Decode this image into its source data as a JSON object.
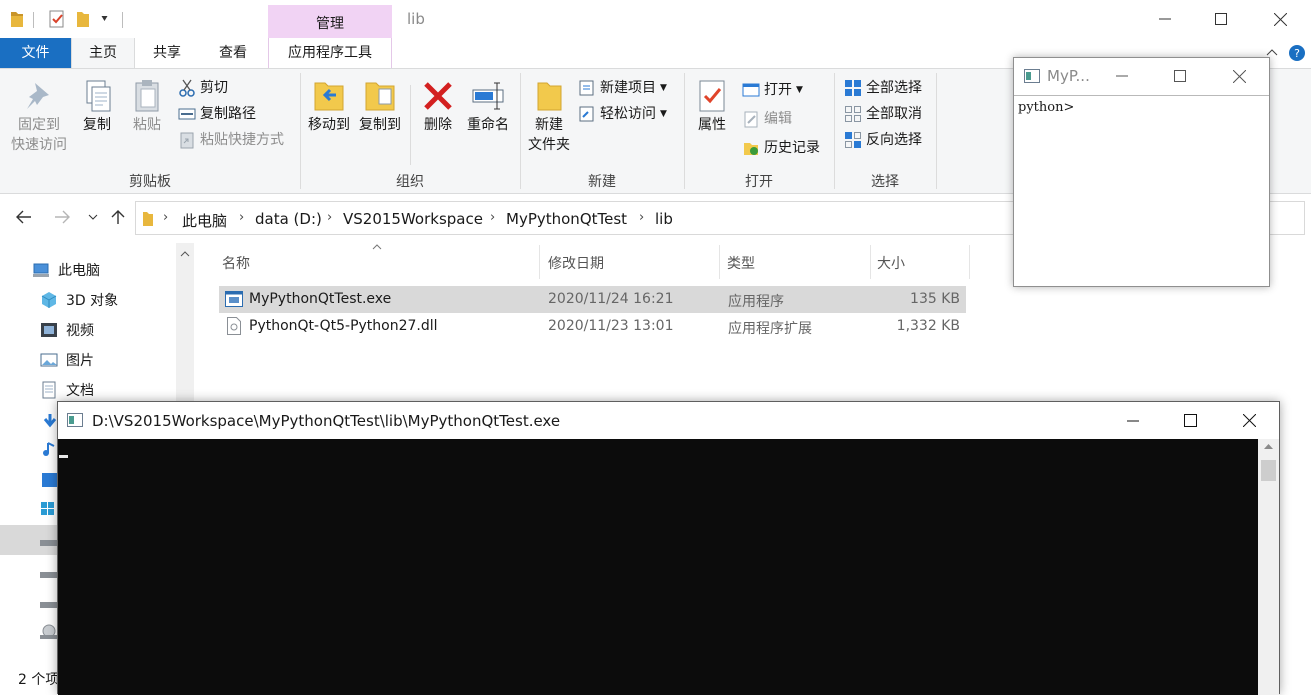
{
  "titlebar": {
    "context_tab_header": "管理",
    "window_title": "lib"
  },
  "ribbon_tabs": {
    "file": "文件",
    "home": "主页",
    "share": "共享",
    "view": "查看",
    "app_tools": "应用程序工具"
  },
  "ribbon": {
    "clipboard": {
      "pin": "固定到快速访问",
      "pin_line1": "固定到",
      "pin_line2": "快速访问",
      "copy": "复制",
      "paste": "粘贴",
      "cut": "剪切",
      "copy_path": "复制路径",
      "paste_shortcut": "粘贴快捷方式",
      "label": "剪贴板"
    },
    "organize": {
      "move_to": "移动到",
      "copy_to": "复制到",
      "delete": "删除",
      "rename": "重命名",
      "label": "组织"
    },
    "new": {
      "new_folder_line1": "新建",
      "new_folder_line2": "文件夹",
      "new_item": "新建项目",
      "easy_access": "轻松访问",
      "label": "新建"
    },
    "open": {
      "properties": "属性",
      "open": "打开",
      "edit": "编辑",
      "history": "历史记录",
      "label": "打开"
    },
    "select": {
      "select_all": "全部选择",
      "select_none": "全部取消",
      "invert": "反向选择",
      "label": "选择"
    }
  },
  "address": {
    "crumbs": [
      "此电脑",
      "data (D:)",
      "VS2015Workspace",
      "MyPythonQtTest",
      "lib"
    ]
  },
  "nav": {
    "items": [
      "此电脑",
      "3D 对象",
      "视频",
      "图片",
      "文档"
    ]
  },
  "columns": {
    "name": "名称",
    "date": "修改日期",
    "type": "类型",
    "size": "大小"
  },
  "files": [
    {
      "name": "MyPythonQtTest.exe",
      "date": "2020/11/24 16:21",
      "type": "应用程序",
      "size": "135 KB"
    },
    {
      "name": "PythonQt-Qt5-Python27.dll",
      "date": "2020/11/23 13:01",
      "type": "应用程序扩展",
      "size": "1,332 KB"
    }
  ],
  "status": {
    "count": "2 个项"
  },
  "pywin": {
    "title": "MyP...",
    "prompt": "python>"
  },
  "console": {
    "title": "D:\\VS2015Workspace\\MyPythonQtTest\\lib\\MyPythonQtTest.exe"
  },
  "colors": {
    "file_tab": "#1a6fc2",
    "context_tab": "#f1d3f4",
    "selection": "#d9d9d9",
    "console_bg": "#0c0c0c"
  }
}
